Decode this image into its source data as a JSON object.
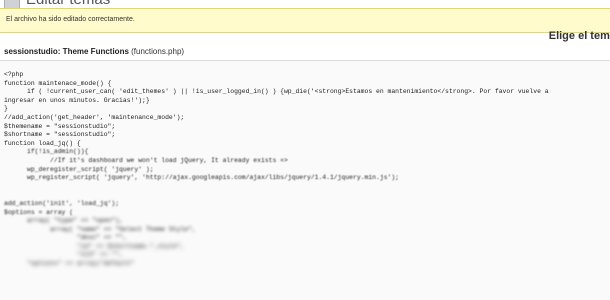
{
  "window": {
    "title": "Editar temas"
  },
  "notice": {
    "message": "El archivo ha sido editado correctamente."
  },
  "sidebar": {
    "choose_theme_label": "Elige el tema"
  },
  "editor": {
    "theme_name": "sessionstudio: Theme Functions",
    "file_name": "(functions.php)",
    "code_lines": [
      "<?php",
      "function maintenace_mode() {",
      "      if ( !current_user_can( 'edit_themes' ) || !is_user_logged_in() ) {wp_die('<strong>Estamos en mantenimiento</strong>. Por favor vuelve a",
      "ingresar en unos minutos. Gracias!');}",
      "}",
      "//add_action('get_header', 'maintenance_mode');",
      "$themename = \"sessionstudio\";",
      "$shortname = \"sessionstudio\";",
      "function load_jq() {",
      "      if(!is_admin()){",
      "            //If it's dashboard we won't load jQuery, It already exists =>",
      "      wp_deregister_script( 'jquery' );",
      "      wp_register_script( 'jquery', 'http://ajax.googleapis.com/ajax/libs/jquery/1.4.1/jquery.min.js');",
      "",
      "",
      "add_action('init', 'load_jq');",
      "$options = array (",
      "      array( \"type\" => \"open\"),",
      "            array( \"name\" => \"Select Theme Style\",",
      "                   \"desc\" => \"\",",
      "                   \"id\" => $shortname.\"_style\",",
      "                   \"std\" => \"\",",
      "      \"options\" => array(\"default\""
    ]
  }
}
